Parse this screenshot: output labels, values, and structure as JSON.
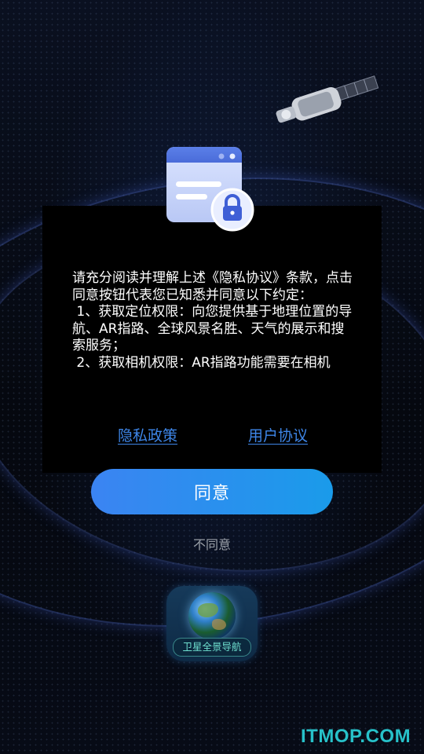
{
  "dialog": {
    "agreement_text": "请充分阅读并理解上述《隐私协议》条款，点击同意按钮代表您已知悉并同意以下约定：\n 1、获取定位权限：向您提供基于地理位置的导航、AR指路、全球风景名胜、天气的展示和搜索服务；\n 2、获取相机权限：AR指路功能需要在相机",
    "privacy_link": "隐私政策",
    "user_link": "用户协议",
    "agree_button": "同意",
    "disagree_button": "不同意"
  },
  "app": {
    "name": "卫星全景导航"
  },
  "watermark": "ITMOP.COM",
  "icons": {
    "dialog_icon": "browser-window-lock-icon",
    "satellite": "satellite-illustration",
    "app_icon": "earth-app-icon"
  },
  "colors": {
    "link": "#3e86e8",
    "button_start": "#3b84f2",
    "button_end": "#1a9bea",
    "watermark": "#27c1c9",
    "background": "#05080f"
  }
}
